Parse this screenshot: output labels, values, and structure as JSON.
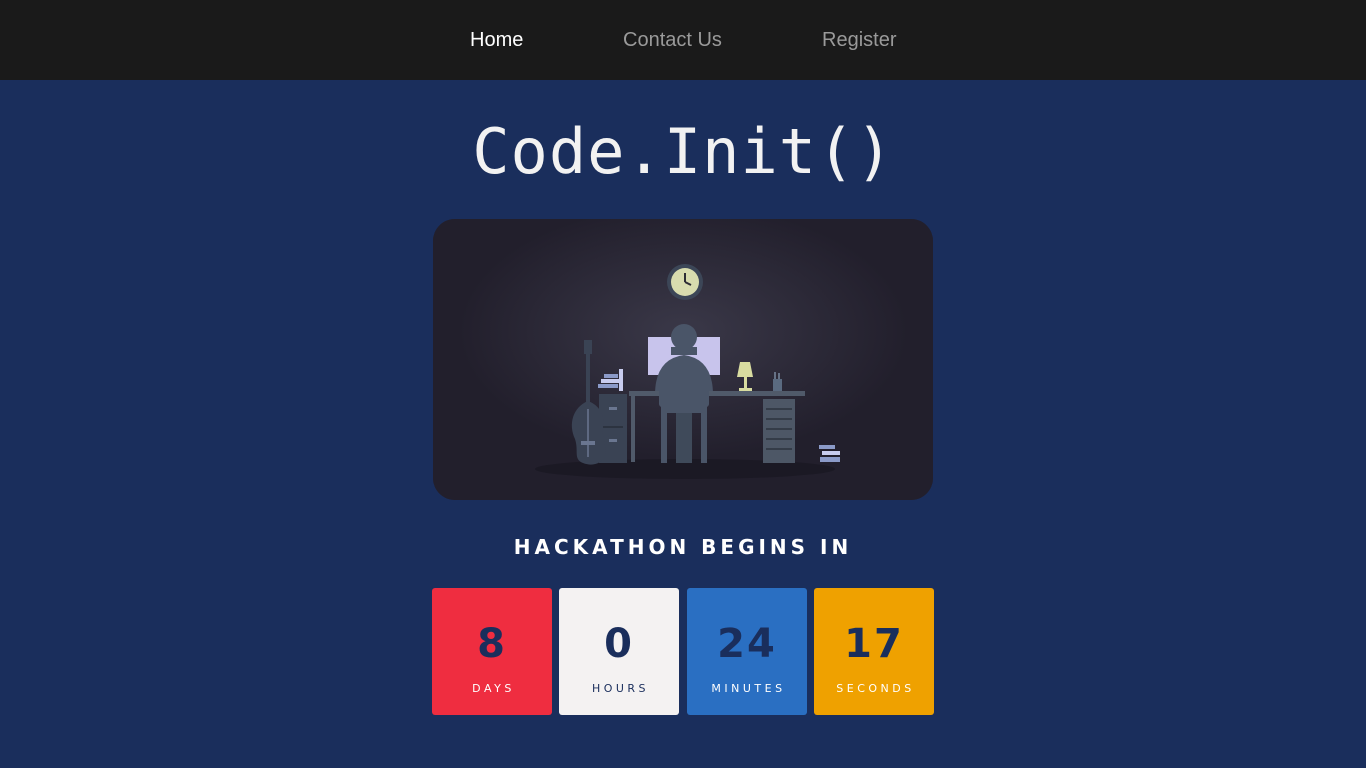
{
  "nav": {
    "home": "Home",
    "contact": "Contact Us",
    "register": "Register"
  },
  "hero": {
    "title": "Code.Init()"
  },
  "countdown": {
    "heading": "HACKATHON BEGINS IN",
    "days": {
      "value": "8",
      "label": "DAYS"
    },
    "hours": {
      "value": "0",
      "label": "HOURS"
    },
    "minutes": {
      "value": "24",
      "label": "MINUTES"
    },
    "seconds": {
      "value": "17",
      "label": "SECONDS"
    }
  },
  "colors": {
    "background": "#1a2e5c",
    "navbar": "#1a1a1a",
    "days": "#ef2d40",
    "hours": "#f4f2f2",
    "minutes": "#2a6fc2",
    "seconds": "#efa100"
  }
}
